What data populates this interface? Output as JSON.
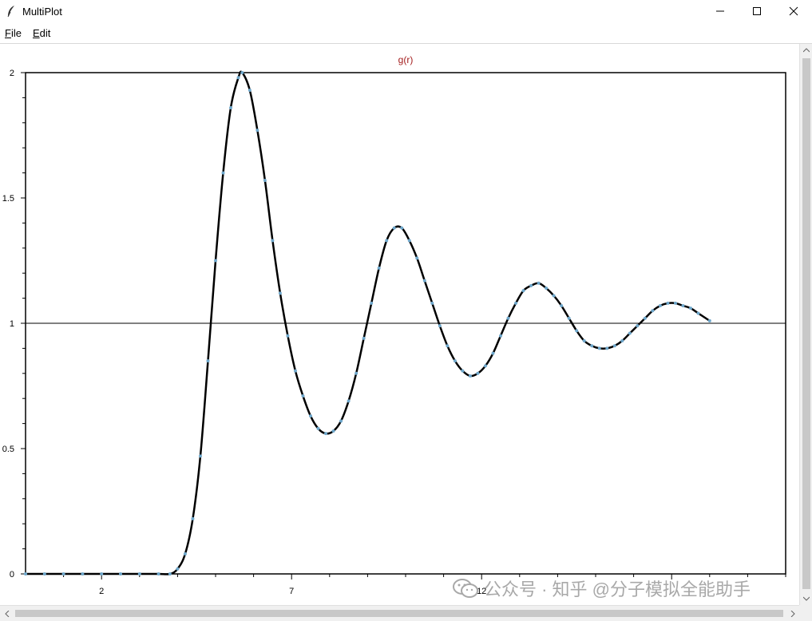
{
  "window": {
    "title": "MultiPlot"
  },
  "menu": {
    "items": [
      {
        "label": "File",
        "mnemonic": "F"
      },
      {
        "label": "Edit",
        "mnemonic": "E"
      }
    ]
  },
  "watermark": {
    "text": "公众号 · 知乎 @分子模拟全能助手"
  },
  "colors": {
    "curve": "#000000",
    "markers": "#6fa8cc",
    "title": "#a31c1c",
    "reference_line": "#000000"
  },
  "chart_data": {
    "type": "line",
    "title": "g(r)",
    "xlabel": "",
    "ylabel": "",
    "xlim": [
      0,
      20
    ],
    "ylim": [
      0,
      2
    ],
    "x_ticks": [
      2,
      7,
      12,
      17
    ],
    "y_ticks": [
      0,
      0.5,
      1,
      1.5,
      2
    ],
    "x_tick_labels": [
      "2",
      "7",
      "12",
      ""
    ],
    "y_tick_labels": [
      "0",
      "0.5",
      "1",
      "1.5",
      "2"
    ],
    "reference_line_y": 1,
    "grid": false,
    "legend": "none",
    "series": [
      {
        "points": [
          [
            0.0,
            0
          ],
          [
            0.5,
            0
          ],
          [
            1.0,
            0
          ],
          [
            1.5,
            0
          ],
          [
            2.0,
            0
          ],
          [
            2.5,
            0
          ],
          [
            3.0,
            0
          ],
          [
            3.5,
            0
          ],
          [
            3.8,
            0
          ],
          [
            4.0,
            0.02
          ],
          [
            4.2,
            0.08
          ],
          [
            4.4,
            0.22
          ],
          [
            4.6,
            0.47
          ],
          [
            4.8,
            0.85
          ],
          [
            5.0,
            1.25
          ],
          [
            5.2,
            1.6
          ],
          [
            5.4,
            1.86
          ],
          [
            5.6,
            1.98
          ],
          [
            5.7,
            2.0
          ],
          [
            5.9,
            1.93
          ],
          [
            6.1,
            1.77
          ],
          [
            6.3,
            1.57
          ],
          [
            6.5,
            1.33
          ],
          [
            6.7,
            1.12
          ],
          [
            6.9,
            0.95
          ],
          [
            7.1,
            0.81
          ],
          [
            7.3,
            0.71
          ],
          [
            7.5,
            0.63
          ],
          [
            7.7,
            0.58
          ],
          [
            7.9,
            0.56
          ],
          [
            8.1,
            0.57
          ],
          [
            8.3,
            0.61
          ],
          [
            8.5,
            0.69
          ],
          [
            8.7,
            0.8
          ],
          [
            8.9,
            0.94
          ],
          [
            9.1,
            1.08
          ],
          [
            9.3,
            1.22
          ],
          [
            9.5,
            1.33
          ],
          [
            9.7,
            1.38
          ],
          [
            9.9,
            1.38
          ],
          [
            10.1,
            1.33
          ],
          [
            10.3,
            1.26
          ],
          [
            10.5,
            1.17
          ],
          [
            10.7,
            1.08
          ],
          [
            10.9,
            0.99
          ],
          [
            11.1,
            0.91
          ],
          [
            11.3,
            0.85
          ],
          [
            11.5,
            0.81
          ],
          [
            11.7,
            0.79
          ],
          [
            11.9,
            0.8
          ],
          [
            12.1,
            0.83
          ],
          [
            12.3,
            0.88
          ],
          [
            12.5,
            0.95
          ],
          [
            12.7,
            1.02
          ],
          [
            12.9,
            1.08
          ],
          [
            13.1,
            1.13
          ],
          [
            13.3,
            1.15
          ],
          [
            13.5,
            1.16
          ],
          [
            13.7,
            1.14
          ],
          [
            13.9,
            1.11
          ],
          [
            14.1,
            1.07
          ],
          [
            14.3,
            1.02
          ],
          [
            14.5,
            0.97
          ],
          [
            14.7,
            0.93
          ],
          [
            14.9,
            0.91
          ],
          [
            15.1,
            0.9
          ],
          [
            15.3,
            0.9
          ],
          [
            15.5,
            0.91
          ],
          [
            15.7,
            0.93
          ],
          [
            15.9,
            0.96
          ],
          [
            16.1,
            0.99
          ],
          [
            16.3,
            1.02
          ],
          [
            16.5,
            1.05
          ],
          [
            16.7,
            1.07
          ],
          [
            16.9,
            1.08
          ],
          [
            17.1,
            1.08
          ],
          [
            17.3,
            1.07
          ],
          [
            17.5,
            1.06
          ],
          [
            17.7,
            1.04
          ],
          [
            18.0,
            1.01
          ]
        ]
      }
    ]
  }
}
